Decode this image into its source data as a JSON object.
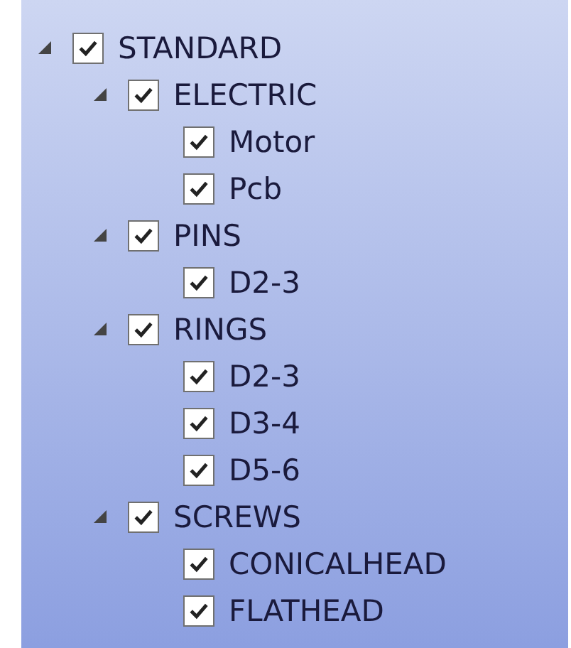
{
  "tree": [
    {
      "label": "STANDARD",
      "checked": true,
      "expanded": true,
      "children": [
        {
          "label": "ELECTRIC",
          "checked": true,
          "expanded": true,
          "children": [
            {
              "label": "Motor",
              "checked": true
            },
            {
              "label": "Pcb",
              "checked": true
            }
          ]
        },
        {
          "label": "PINS",
          "checked": true,
          "expanded": true,
          "children": [
            {
              "label": "D2-3",
              "checked": true
            }
          ]
        },
        {
          "label": "RINGS",
          "checked": true,
          "expanded": true,
          "children": [
            {
              "label": "D2-3",
              "checked": true
            },
            {
              "label": "D3-4",
              "checked": true
            },
            {
              "label": "D5-6",
              "checked": true
            }
          ]
        },
        {
          "label": "SCREWS",
          "checked": true,
          "expanded": true,
          "children": [
            {
              "label": "CONICALHEAD",
              "checked": true
            },
            {
              "label": "FLATHEAD",
              "checked": true
            }
          ]
        }
      ]
    }
  ]
}
